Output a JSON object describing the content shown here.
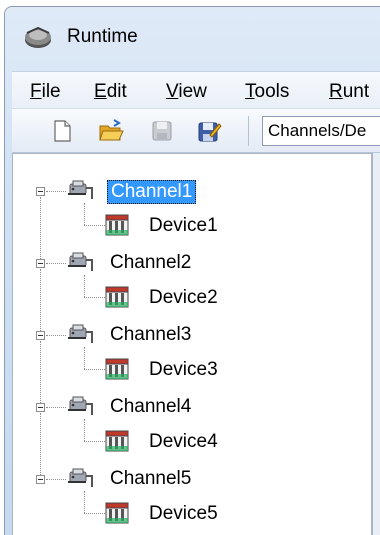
{
  "window": {
    "title": "Runtime"
  },
  "menu": [
    {
      "label": "File",
      "mnemonic": "F",
      "rest": "ile"
    },
    {
      "label": "Edit",
      "mnemonic": "E",
      "rest": "dit"
    },
    {
      "label": "View",
      "mnemonic": "V",
      "rest": "iew"
    },
    {
      "label": "Tools",
      "mnemonic": "T",
      "rest": "ools"
    },
    {
      "label": "Runt",
      "mnemonic": "R",
      "rest": "unt"
    }
  ],
  "toolbar": {
    "buttons": [
      "new-icon",
      "open-folder-icon",
      "save-icon",
      "save-as-icon"
    ],
    "address_value": "Channels/De"
  },
  "tree": {
    "nodes": [
      {
        "channel": "Channel1",
        "device": "Device1",
        "selected": true
      },
      {
        "channel": "Channel2",
        "device": "Device2",
        "selected": false
      },
      {
        "channel": "Channel3",
        "device": "Device3",
        "selected": false
      },
      {
        "channel": "Channel4",
        "device": "Device4",
        "selected": false
      },
      {
        "channel": "Channel5",
        "device": "Device5",
        "selected": false
      }
    ]
  },
  "colors": {
    "selection": "#3399ff",
    "chrome": "#cfe0f3"
  }
}
